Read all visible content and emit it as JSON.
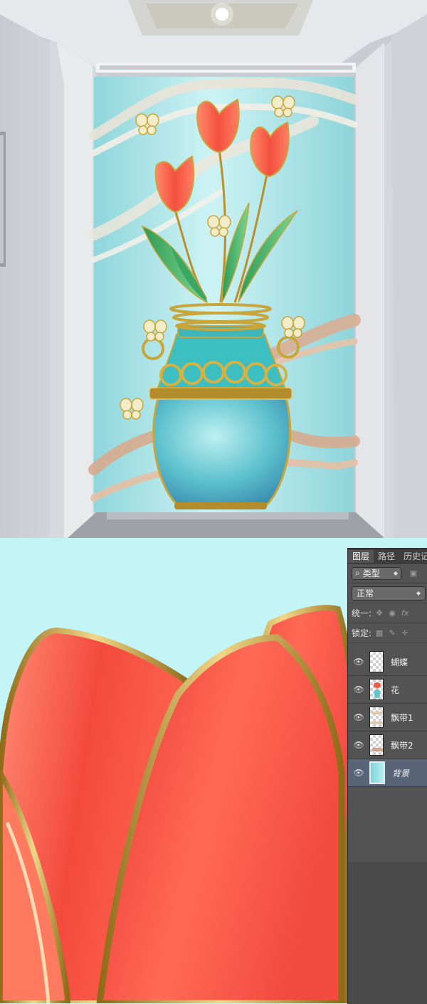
{
  "layers_panel": {
    "tabs": [
      "图层",
      "路径",
      "历史记"
    ],
    "active_tab": 0,
    "filter": {
      "label": "类型",
      "search_icon": "search-icon"
    },
    "blend_mode": "正常",
    "unify_label": "统一:",
    "lock_label": "锁定:",
    "layers": [
      {
        "name": "蝴蝶",
        "visible": true,
        "thumb": "transparent-butterflies"
      },
      {
        "name": "花",
        "visible": true,
        "thumb": "flower-vase"
      },
      {
        "name": "飘带1",
        "visible": true,
        "thumb": "ribbon"
      },
      {
        "name": "飘带2",
        "visible": true,
        "thumb": "ribbon"
      },
      {
        "name": "背景",
        "visible": true,
        "thumb": "background",
        "selected": true
      }
    ]
  },
  "colors": {
    "panel_bg": "#535353",
    "selected_layer": "#586478",
    "artwork_bg": "#bfeef0",
    "tulip_red": "#f2483f",
    "gold": "#c9a63a"
  }
}
